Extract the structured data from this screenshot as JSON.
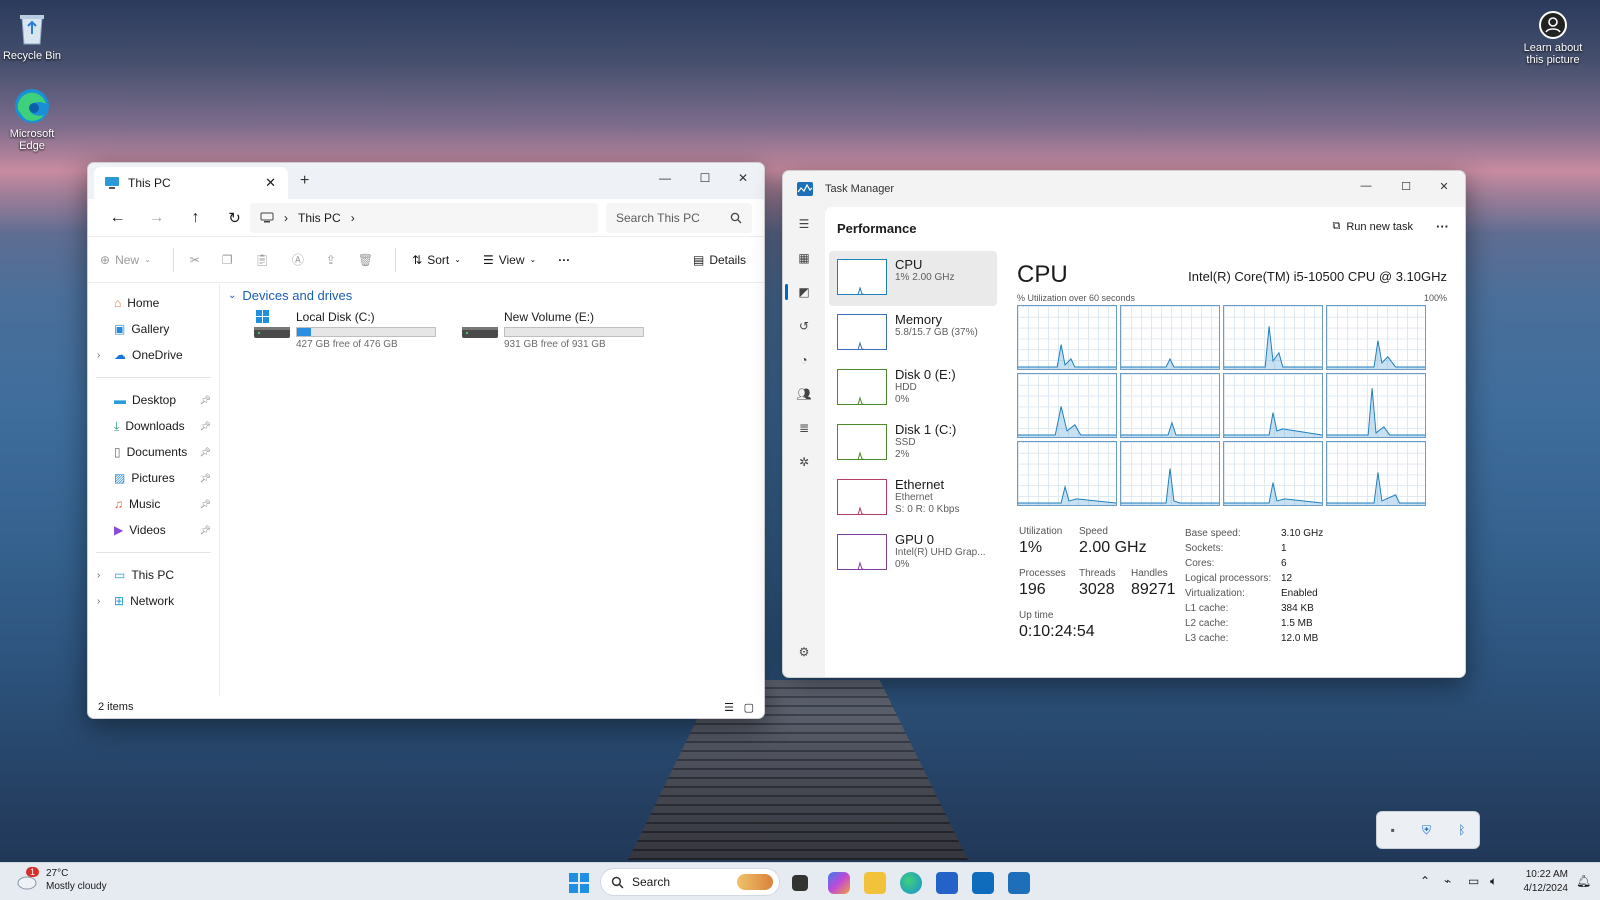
{
  "desktop": {
    "icons": [
      {
        "label": "Recycle Bin"
      },
      {
        "label": "Microsoft Edge"
      }
    ],
    "spotlight": {
      "label": "Learn about this picture"
    }
  },
  "explorer": {
    "tab_title": "This PC",
    "address": "This PC",
    "search_placeholder": "Search This PC",
    "commands": {
      "new": "New",
      "sort": "Sort",
      "view": "View",
      "details": "Details"
    },
    "sidebar": {
      "top": [
        {
          "label": "Home"
        },
        {
          "label": "Gallery"
        },
        {
          "label": "OneDrive"
        }
      ],
      "pinned": [
        {
          "label": "Desktop"
        },
        {
          "label": "Downloads"
        },
        {
          "label": "Documents"
        },
        {
          "label": "Pictures"
        },
        {
          "label": "Music"
        },
        {
          "label": "Videos"
        }
      ],
      "bottom": [
        {
          "label": "This PC"
        },
        {
          "label": "Network"
        }
      ]
    },
    "group_header": "Devices and drives",
    "drives": [
      {
        "name": "Local Disk (C:)",
        "free": "427 GB free of 476 GB",
        "used_fraction": 0.103
      },
      {
        "name": "New Volume (E:)",
        "free": "931 GB free of 931 GB",
        "used_fraction": 0.0
      }
    ],
    "status": "2 items"
  },
  "taskmgr": {
    "title": "Task Manager",
    "section": "Performance",
    "run_new_task": "Run new task",
    "resources": [
      {
        "name": "CPU",
        "sub1": "1% 2.00 GHz",
        "sub2": "",
        "color": "#1f7fbf"
      },
      {
        "name": "Memory",
        "sub1": "5.8/15.7 GB (37%)",
        "sub2": "",
        "color": "#3e6fbd"
      },
      {
        "name": "Disk 0 (E:)",
        "sub1": "HDD",
        "sub2": "0%",
        "color": "#4d8a2a"
      },
      {
        "name": "Disk 1 (C:)",
        "sub1": "SSD",
        "sub2": "2%",
        "color": "#4d8a2a"
      },
      {
        "name": "Ethernet",
        "sub1": "Ethernet",
        "sub2": "S: 0 R: 0 Kbps",
        "color": "#b04060"
      },
      {
        "name": "GPU 0",
        "sub1": "Intel(R) UHD Grap...",
        "sub2": "0%",
        "color": "#8040a0"
      }
    ],
    "cpu": {
      "heading": "CPU",
      "model": "Intel(R) Core(TM) i5-10500 CPU @ 3.10GHz",
      "util_label": "% Utilization over 60 seconds",
      "util_max": "100%",
      "stats": {
        "utilization_label": "Utilization",
        "utilization": "1%",
        "speed_label": "Speed",
        "speed": "2.00 GHz",
        "processes_label": "Processes",
        "processes": "196",
        "threads_label": "Threads",
        "threads": "3028",
        "handles_label": "Handles",
        "handles": "89271",
        "uptime_label": "Up time",
        "uptime": "0:10:24:54"
      },
      "specs": [
        {
          "label": "Base speed:",
          "value": "3.10 GHz"
        },
        {
          "label": "Sockets:",
          "value": "1"
        },
        {
          "label": "Cores:",
          "value": "6"
        },
        {
          "label": "Logical processors:",
          "value": "12"
        },
        {
          "label": "Virtualization:",
          "value": "Enabled"
        },
        {
          "label": "L1 cache:",
          "value": "384 KB"
        },
        {
          "label": "L2 cache:",
          "value": "1.5 MB"
        },
        {
          "label": "L3 cache:",
          "value": "12.0 MB"
        }
      ]
    }
  },
  "taskbar": {
    "weather": {
      "temp": "27°C",
      "desc": "Mostly cloudy",
      "badge": "1"
    },
    "search_placeholder": "Search",
    "clock": {
      "time": "10:22 AM",
      "date": "4/12/2024"
    }
  }
}
